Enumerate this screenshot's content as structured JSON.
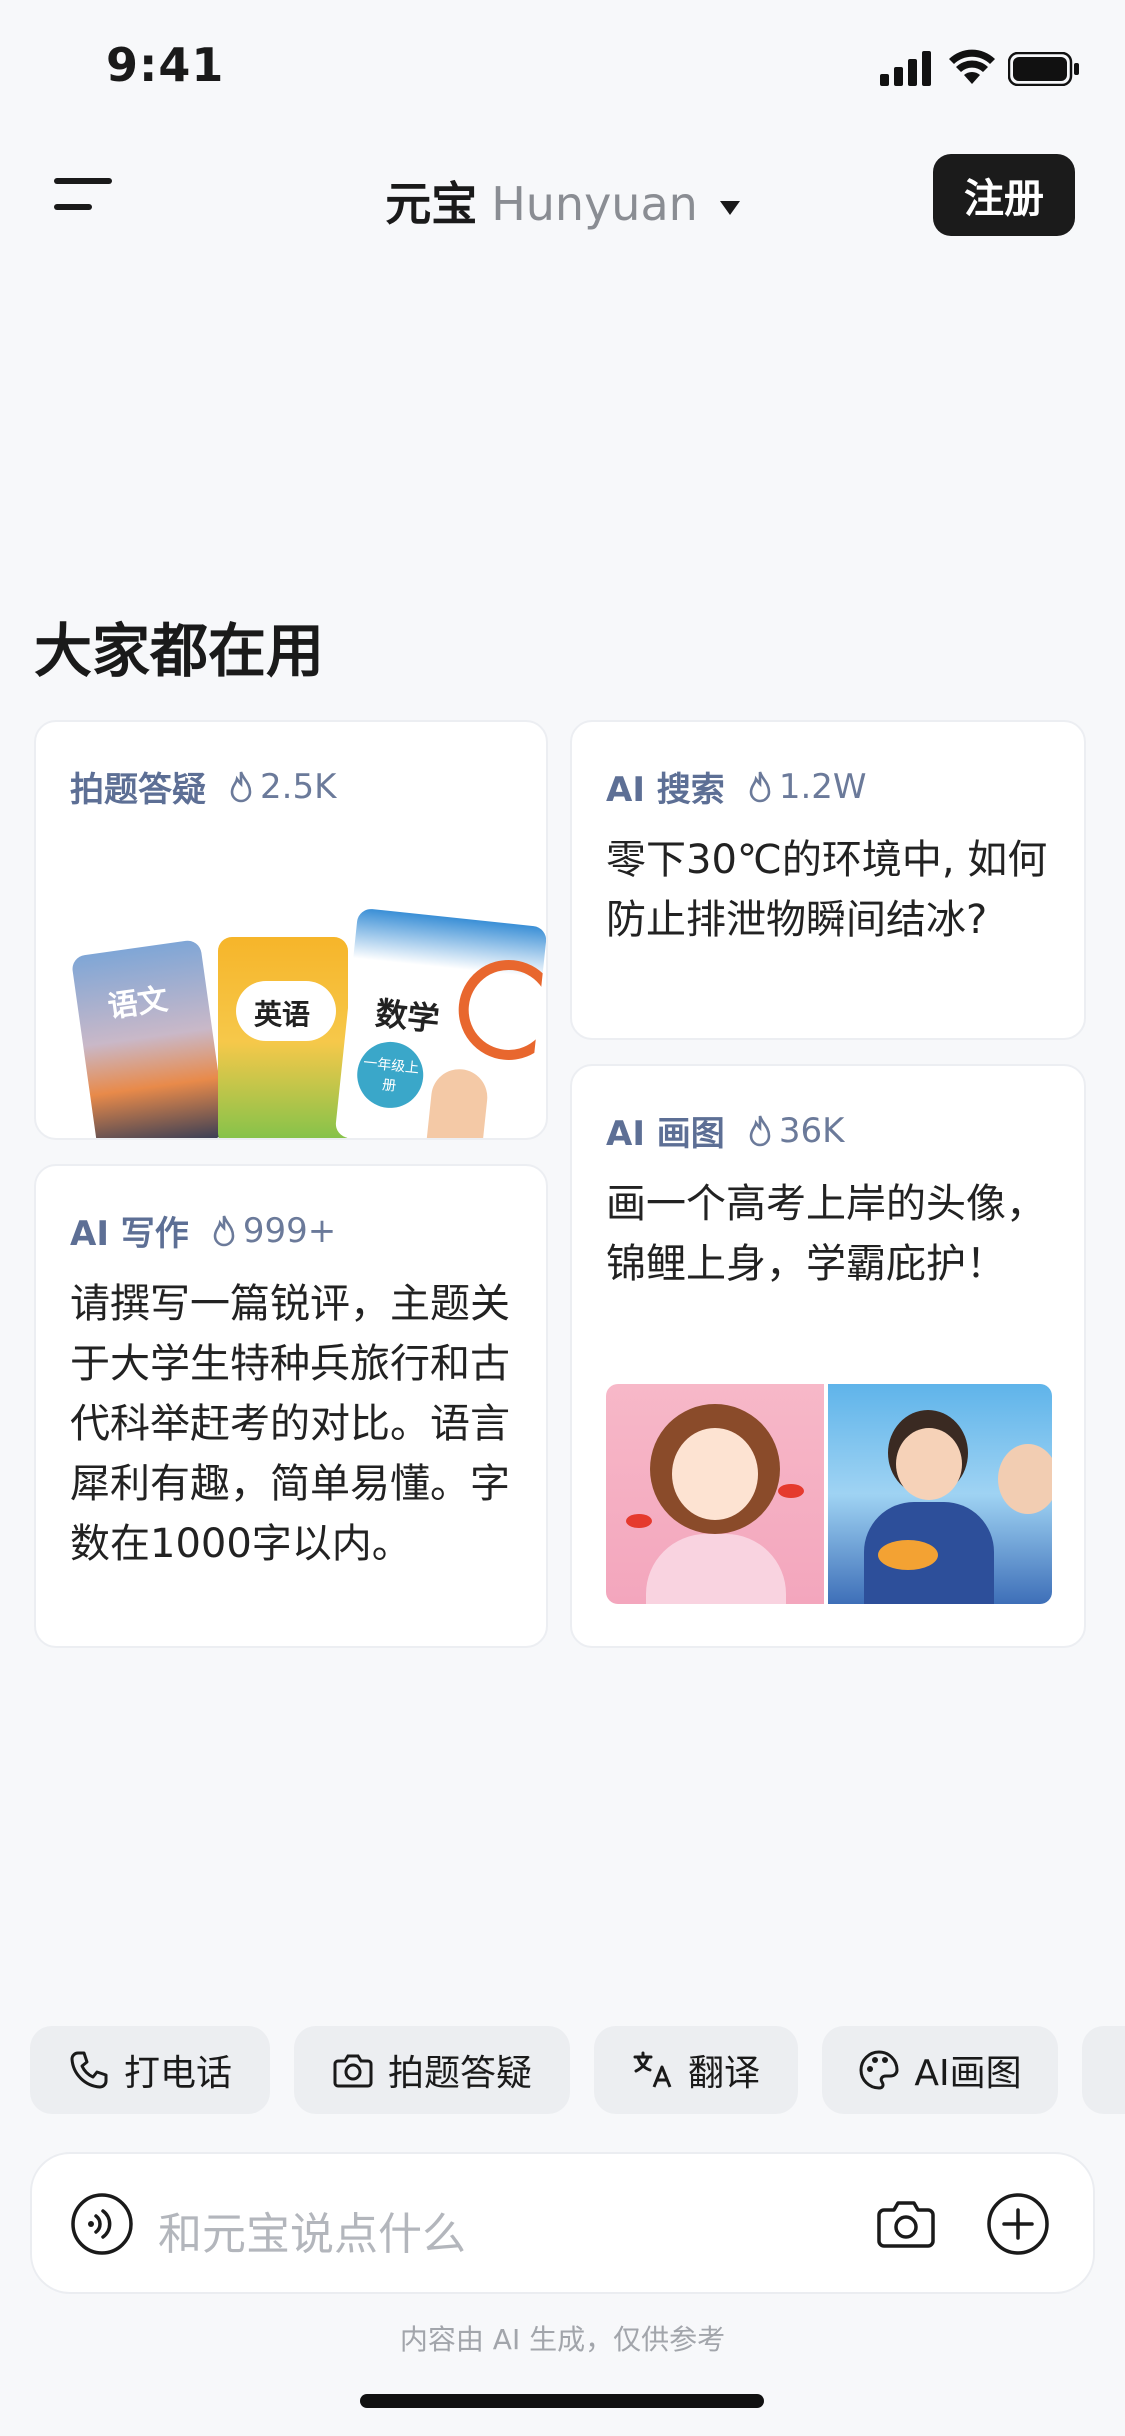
{
  "status_bar": {
    "time": "9:41"
  },
  "header": {
    "app_name": "元宝",
    "model_name": "Hunyuan",
    "register_label": "注册"
  },
  "section": {
    "title": "大家都在用"
  },
  "cards": {
    "photo_qa": {
      "category": "拍题答疑",
      "heat": "2.5K"
    },
    "ai_search": {
      "category": "AI 搜索",
      "heat": "1.2W",
      "prompt": "零下30℃的环境中, 如何防止排泄物瞬间结冰?"
    },
    "ai_writing": {
      "category": "AI 写作",
      "heat": "999+",
      "prompt": "请撰写一篇锐评，主题关于大学生特种兵旅行和古代科举赶考的对比。语言犀利有趣，简单易懂。字数在1000字以内。"
    },
    "ai_drawing": {
      "category": "AI 画图",
      "heat": "36K",
      "prompt": "画一个高考上岸的头像，锦鲤上身，学霸庇护！"
    }
  },
  "books": {
    "chinese": "语文",
    "english": "英语",
    "math": "数学",
    "grade": "一年级上册"
  },
  "quick_actions": [
    {
      "label": "打电话",
      "icon": "phone-icon"
    },
    {
      "label": "拍题答疑",
      "icon": "camera-icon"
    },
    {
      "label": "翻译",
      "icon": "translate-icon"
    },
    {
      "label": "AI画图",
      "icon": "palette-icon"
    }
  ],
  "input": {
    "placeholder": "和元宝说点什么"
  },
  "footer": {
    "note": "内容由 AI 生成，仅供参考"
  },
  "colors": {
    "accent": "#5d6f95",
    "button_dark": "#1b1b1b",
    "background": "#f7f8fa"
  }
}
